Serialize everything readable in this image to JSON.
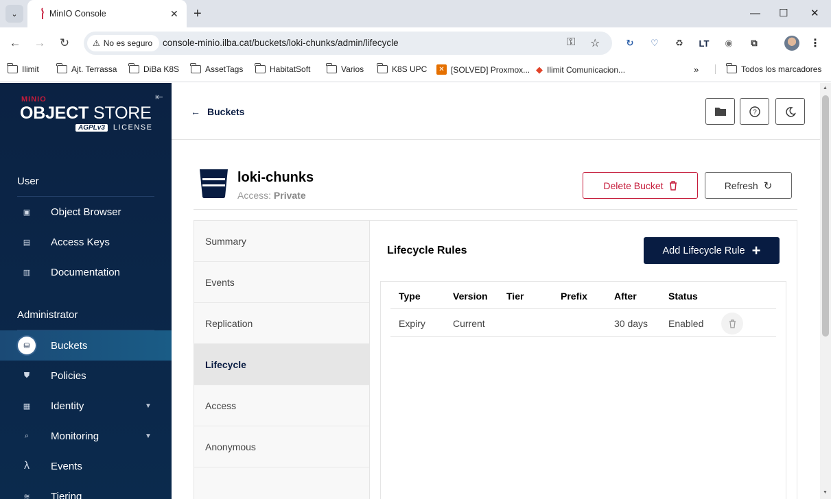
{
  "browser": {
    "tab_title": "MinIO Console",
    "security_label": "No es seguro",
    "url": "console-minio.ilba.cat/buckets/loki-chunks/admin/lifecycle",
    "bookmarks": [
      "Ilimit",
      "Ajt. Terrassa",
      "DiBa K8S",
      "AssetTags",
      "HabitatSoft",
      "Varios",
      "K8S UPC",
      "[SOLVED] Proxmox...",
      "Ilimit Comunicacion..."
    ],
    "all_bookmarks": "Todos los marcadores"
  },
  "sidebar": {
    "logo_small": "MINIO",
    "logo_object": "OBJECT",
    "logo_store": "STORE",
    "logo_agpl": "AGPLv3",
    "logo_license": "LICENSE",
    "user_section": "User",
    "user_items": [
      "Object Browser",
      "Access Keys",
      "Documentation"
    ],
    "admin_section": "Administrator",
    "admin_items": [
      "Buckets",
      "Policies",
      "Identity",
      "Monitoring",
      "Events",
      "Tiering"
    ]
  },
  "header": {
    "back_label": "Buckets"
  },
  "bucket": {
    "name": "loki-chunks",
    "access_label": "Access:",
    "access_value": "Private",
    "delete_label": "Delete Bucket",
    "refresh_label": "Refresh"
  },
  "tabs": [
    "Summary",
    "Events",
    "Replication",
    "Lifecycle",
    "Access",
    "Anonymous"
  ],
  "lifecycle": {
    "title": "Lifecycle Rules",
    "add_label": "Add Lifecycle Rule",
    "columns": [
      "Type",
      "Version",
      "Tier",
      "Prefix",
      "After",
      "Status"
    ],
    "rows": [
      {
        "type": "Expiry",
        "version": "Current",
        "tier": "",
        "prefix": "",
        "after": "30 days",
        "status": "Enabled"
      }
    ]
  },
  "colors": {
    "sidebar_bg": "#0b2243",
    "accent": "#081c42",
    "danger": "#c51b3a"
  }
}
